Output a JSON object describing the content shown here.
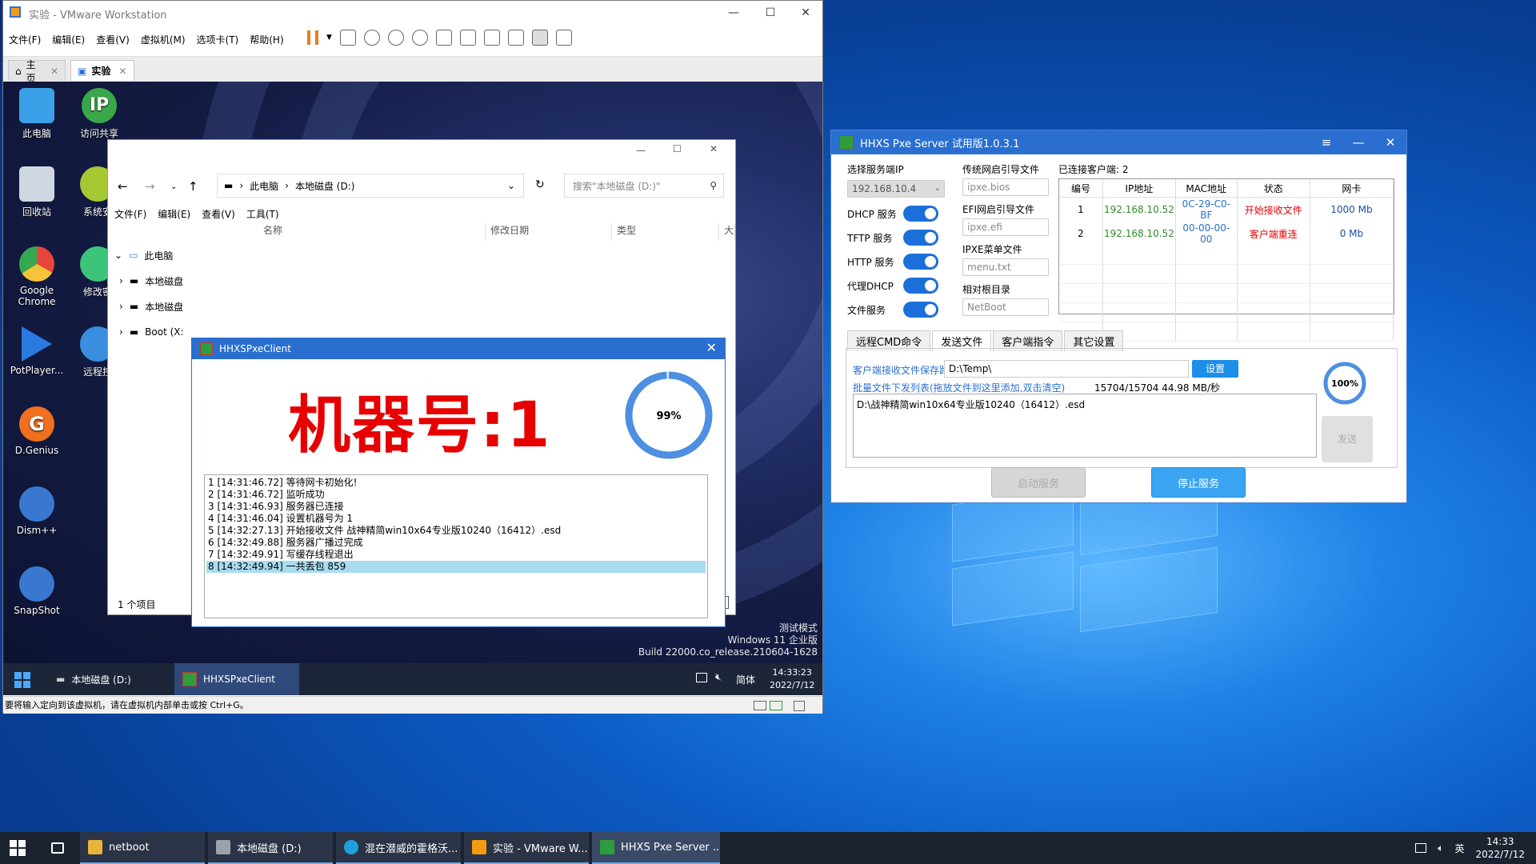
{
  "host": {
    "taskbar": {
      "items": [
        {
          "label": "netboot",
          "color": "#e8b53a"
        },
        {
          "label": "本地磁盘 (D:)",
          "color": "#9aa3ad"
        },
        {
          "label": "混在潜威的霍格沃...",
          "color": "#1ea0e0"
        },
        {
          "label": "实验 - VMware W...",
          "color": "#f39c12"
        },
        {
          "label": "HHXS Pxe Server ...",
          "color": "#2e9d3e"
        }
      ],
      "ime": "英",
      "time": "14:33",
      "date": "2022/7/12"
    }
  },
  "vmware": {
    "title": "实验 - VMware Workstation",
    "menu": [
      "文件(F)",
      "编辑(E)",
      "查看(V)",
      "虚拟机(M)",
      "选项卡(T)",
      "帮助(H)"
    ],
    "tabs": [
      "主页",
      "实验"
    ],
    "status_text": "要将输入定向到该虚拟机，请在虚拟机内部单击或按 Ctrl+G。"
  },
  "guest": {
    "desktop_icons": [
      {
        "label": "此电脑",
        "color": "#3aa0e8"
      },
      {
        "label": "访问共享",
        "color": "#3aa84a"
      },
      {
        "label": "回收站",
        "color": "#cfd8e0"
      },
      {
        "label": "系统安",
        "color": "#a6c832"
      },
      {
        "label": "Google Chrome",
        "color": "#e8453c"
      },
      {
        "label": "修改密",
        "color": "#3cc47a"
      },
      {
        "label": "PotPlayer...",
        "color": "#2a7ae0"
      },
      {
        "label": "远程控",
        "color": "#3a8ee0"
      },
      {
        "label": "D.Genius",
        "color": "#f07020"
      },
      {
        "label": "Dism++",
        "color": "#3a78d0"
      },
      {
        "label": "SnapShot",
        "color": "#3a78d0"
      }
    ],
    "watermark": [
      "测试模式",
      "Windows 11 企业版",
      "Build 22000.co_release.210604-1628"
    ],
    "taskbar": {
      "items": [
        "本地磁盘 (D:)",
        "HHXSPxeClient"
      ],
      "ime": "简体",
      "time": "14:33:23",
      "date": "2022/7/12"
    }
  },
  "explorer": {
    "breadcrumb": [
      "此电脑",
      "本地磁盘 (D:)"
    ],
    "search_placeholder": "搜索\"本地磁盘 (D:)\"",
    "menu": [
      "文件(F)",
      "编辑(E)",
      "查看(V)",
      "工具(T)"
    ],
    "columns": [
      "名称",
      "修改日期",
      "类型",
      "大"
    ],
    "tree": [
      "此电脑",
      "本地磁盘",
      "本地磁盘",
      "Boot (X:"
    ],
    "footer": "1 个项目"
  },
  "client": {
    "title": "HHXSPxeClient",
    "machine_label": "机器号:1",
    "progress_text": "99%",
    "progress": 0.99,
    "log": [
      "1 [14:31:46.72] 等待网卡初始化!",
      "2 [14:31:46.72] 监听成功",
      "3 [14:31:46.93] 服务器已连接",
      "4 [14:31:46.04] 设置机器号为 1",
      "5 [14:32:27.13] 开始接收文件 战神精简win10x64专业版10240（16412）.esd",
      "6 [14:32:49.88] 服务器广播过完成",
      "7 [14:32:49.91] 写缓存线程退出",
      "8 [14:32:49.94] 一共丢包 859"
    ]
  },
  "server": {
    "title": "HHXS Pxe Server 试用版1.0.3.1",
    "labels": {
      "ip": "选择服务端IP",
      "dhcp": "DHCP 服务",
      "tftp": "TFTP 服务",
      "http": "HTTP 服务",
      "proxy": "代理DHCP",
      "file": "文件服务",
      "legacy": "传统网启引导文件",
      "efi": "EFI网启引导文件",
      "ipxe": "IPXE菜单文件",
      "root": "相对根目录",
      "connected": "已连接客户端: 2"
    },
    "values": {
      "ip": "192.168.10.4",
      "legacy": "ipxe.bios",
      "efi": "ipxe.efi",
      "ipxe": "menu.txt",
      "root": "NetBoot"
    },
    "table": {
      "headers": [
        "编号",
        "IP地址",
        "MAC地址",
        "状态",
        "网卡"
      ],
      "rows": [
        {
          "id": "1",
          "ip": "192.168.10.52",
          "mac": "0C-29-C0-BF",
          "status": "开始接收文件",
          "nic": "1000 Mb"
        },
        {
          "id": "2",
          "ip": "192.168.10.52",
          "mac": "00-00-00-00",
          "status": "客户端重连",
          "nic": "0 Mb"
        }
      ]
    },
    "tabs": [
      "远程CMD命令",
      "发送文件",
      "客户端指令",
      "其它设置"
    ],
    "save_path_label": "客户端接收文件保存路径:",
    "save_path": "D:\\Temp\\",
    "set_button": "设置",
    "batch_label": "批量文件下发列表(拖放文件到这里添加,双击清空)",
    "transfer_stats": "15704/15704  44.98 MB/秒",
    "file_item": "D:\\战神精简win10x64专业版10240（16412）.esd",
    "progress_text": "100%",
    "progress": 1.0,
    "send_button": "发送",
    "start_button": "启动服务",
    "stop_button": "停止服务"
  }
}
